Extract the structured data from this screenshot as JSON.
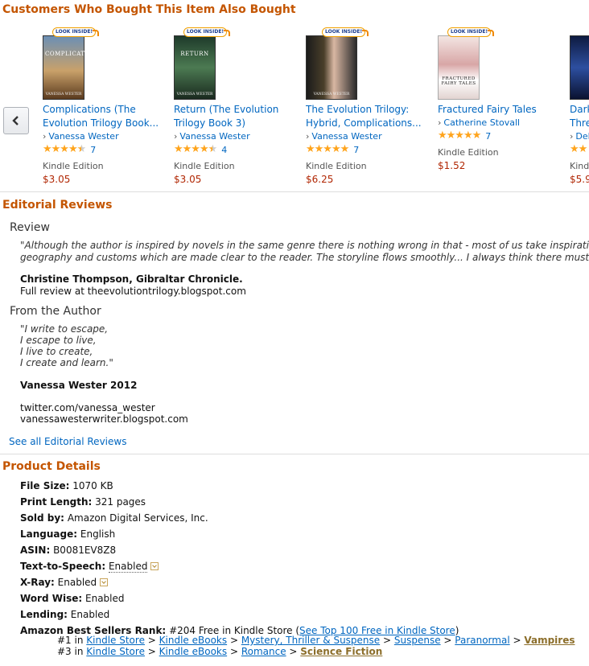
{
  "carousel": {
    "heading": "Customers Who Bought This Item Also Bought",
    "badge": "LOOK INSIDE!",
    "items": [
      {
        "title1": "Complications (The",
        "title2": "Evolution Trilogy Book...",
        "author": "Vanessa Wester",
        "stars": "★★★★★",
        "rating": 4.5,
        "count": "7",
        "format": "Kindle Edition",
        "price": "$3.05",
        "cover_title": "COMPLICATIONS",
        "cover_author": "VANESSA WESTER",
        "cover_color": "#a9773f"
      },
      {
        "title1": "Return (The Evolution",
        "title2": "Trilogy Book 3)",
        "author": "Vanessa Wester",
        "stars": "★★★★★",
        "rating": 4.5,
        "count": "4",
        "format": "Kindle Edition",
        "price": "$3.05",
        "cover_title": "RETURN",
        "cover_author": "VANESSA WESTER",
        "cover_color": "#2f5a3c"
      },
      {
        "title1": "The Evolution Trilogy:",
        "title2": "Hybrid, Complications...",
        "author": "Vanessa Wester",
        "stars": "★★★★★",
        "rating": 5,
        "count": "7",
        "format": "Kindle Edition",
        "price": "$6.25",
        "cover_title": "",
        "cover_author": "VANESSA WESTER",
        "cover_color": "#2a2a2a"
      },
      {
        "title1": "Fractured Fairy Tales",
        "title2": "",
        "author": "Catherine Stovall",
        "stars": "★★★★★",
        "rating": 5,
        "count": "7",
        "format": "Kindle Edition",
        "price": "$1.52",
        "cover_title": "FRACTURED FAIRY TALES",
        "cover_author": "",
        "cover_color": "#e7d7d3"
      },
      {
        "title1": "Dark",
        "title2": "Thre",
        "author": "Del",
        "stars": "★★",
        "rating": 2,
        "count": "",
        "format": "Kindl",
        "price": "$5.9",
        "cover_title": "",
        "cover_author": "",
        "cover_color": "#1c2a5a"
      }
    ]
  },
  "editorial": {
    "heading": "Editorial Reviews",
    "review_label": "Review",
    "review_line1": "\"Although the author is inspired by novels in the same genre there is nothing wrong in that - most of us take inspiration fr",
    "review_line2": "geography and customs which are made clear to the reader. The storyline flows smoothly... I always think there must be",
    "reviewer": "Christine Thompson, Gibraltar Chronicle.",
    "review_source": "Full review at theevolutiontrilogy.blogspot.com",
    "author_label": "From the Author",
    "poem": [
      "\"I write to escape,",
      "I escape to live,",
      "I live to create,",
      "I create and learn.\""
    ],
    "signature": "Vanessa Wester 2012",
    "twitter": "twitter.com/vanessa_wester",
    "blog": "vanessawesterwriter.blogspot.com",
    "see_all": "See all Editorial Reviews"
  },
  "details": {
    "heading": "Product Details",
    "rows": [
      {
        "k": "File Size:",
        "v": "1070 KB"
      },
      {
        "k": "Print Length:",
        "v": "321 pages"
      },
      {
        "k": "Sold by:",
        "v": "Amazon Digital Services, Inc."
      },
      {
        "k": "Language:",
        "v": "English"
      },
      {
        "k": "ASIN:",
        "v": "B0081EV8Z8"
      }
    ],
    "tts_k": "Text-to-Speech:",
    "tts_v": "Enabled",
    "xray_k": "X-Ray:",
    "xray_v": "Enabled",
    "wordwise_k": "Word Wise:",
    "wordwise_v": "Enabled",
    "lending_k": "Lending:",
    "lending_v": "Enabled",
    "rank_k": "Amazon Best Sellers Rank:",
    "rank_v": "#204 Free in Kindle Store (",
    "rank_link": "See Top 100 Free in Kindle Store",
    "rank_close": ")",
    "rank1": {
      "num": "#1 in",
      "path": [
        "Kindle Store",
        "Kindle eBooks",
        "Mystery, Thriller & Suspense",
        "Suspense",
        "Paranormal"
      ],
      "last": "Vampires"
    },
    "rank2": {
      "num": "#3 in",
      "path": [
        "Kindle Store",
        "Kindle eBooks",
        "Romance"
      ],
      "last": "Science Fiction"
    }
  }
}
